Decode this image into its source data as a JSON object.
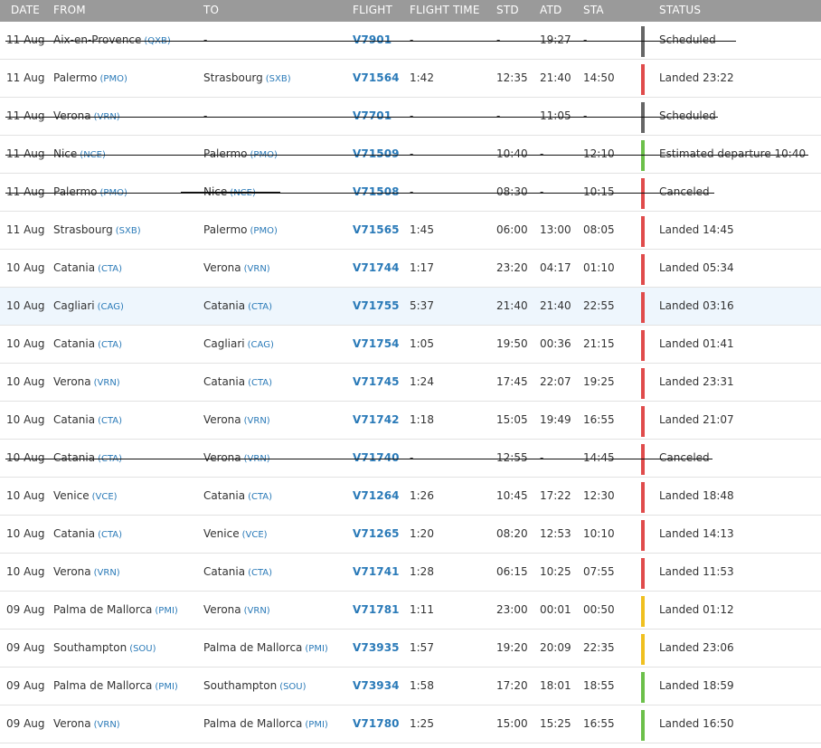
{
  "headers": {
    "date": "DATE",
    "from": "FROM",
    "to": "TO",
    "flight": "FLIGHT",
    "flight_time": "FLIGHT TIME",
    "std": "STD",
    "atd": "ATD",
    "sta": "STA",
    "status": "STATUS"
  },
  "colors": {
    "header_bg": "#9a9a9a",
    "link_blue": "#2a7ab8",
    "status_landed": "#e04b4b",
    "status_scheduled": "#666666",
    "status_estimated": "#6cc04a",
    "status_early": "#f0c020",
    "highlight_row": "#eef6fd"
  },
  "rows": [
    {
      "date": "11 Aug",
      "from": "Aix-en-Provence",
      "from_code": "(QXB)",
      "to": "-",
      "to_code": "",
      "flight": "V7901",
      "flight_time": "-",
      "std": "-",
      "atd": "19:27",
      "sta": "-",
      "status": "Scheduled",
      "bar": "gray",
      "struck": true,
      "strike": "c1"
    },
    {
      "date": "11 Aug",
      "from": "Palermo",
      "from_code": "(PMO)",
      "to": "Strasbourg",
      "to_code": "(SXB)",
      "flight": "V71564",
      "flight_time": "1:42",
      "std": "12:35",
      "atd": "21:40",
      "sta": "14:50",
      "status": "Landed 23:22",
      "bar": "red",
      "struck": false
    },
    {
      "date": "11 Aug",
      "from": "Verona",
      "from_code": "(VRN)",
      "to": "-",
      "to_code": "",
      "flight": "V7701",
      "flight_time": "-",
      "std": "-",
      "atd": "11:05",
      "sta": "-",
      "status": "Scheduled",
      "bar": "gray",
      "struck": true,
      "strike": "c2"
    },
    {
      "date": "11 Aug",
      "from": "Nice",
      "from_code": "(NCE)",
      "to": "Palermo",
      "to_code": "(PMO)",
      "flight": "V71509",
      "flight_time": "-",
      "std": "10:40",
      "atd": "-",
      "sta": "12:10",
      "status": "Estimated departure 10:40",
      "bar": "green",
      "struck": true,
      "strike": "c3"
    },
    {
      "date": "11 Aug",
      "from": "Palermo",
      "from_code": "(PMO)",
      "to": "Nice",
      "to_code": "(NCE)",
      "flight": "V71508",
      "flight_time": "-",
      "std": "08:30",
      "atd": "-",
      "sta": "10:15",
      "status": "Canceled",
      "bar": "red",
      "struck": true,
      "strike": "c4",
      "partial": true
    },
    {
      "date": "11 Aug",
      "from": "Strasbourg",
      "from_code": "(SXB)",
      "to": "Palermo",
      "to_code": "(PMO)",
      "flight": "V71565",
      "flight_time": "1:45",
      "std": "06:00",
      "atd": "13:00",
      "sta": "08:05",
      "status": "Landed 14:45",
      "bar": "red",
      "struck": false
    },
    {
      "date": "10 Aug",
      "from": "Catania",
      "from_code": "(CTA)",
      "to": "Verona",
      "to_code": "(VRN)",
      "flight": "V71744",
      "flight_time": "1:17",
      "std": "23:20",
      "atd": "04:17",
      "sta": "01:10",
      "status": "Landed 05:34",
      "bar": "red",
      "struck": false
    },
    {
      "date": "10 Aug",
      "from": "Cagliari",
      "from_code": "(CAG)",
      "to": "Catania",
      "to_code": "(CTA)",
      "flight": "V71755",
      "flight_time": "5:37",
      "std": "21:40",
      "atd": "21:40",
      "sta": "22:55",
      "status": "Landed 03:16",
      "bar": "red",
      "struck": false,
      "highlight": true
    },
    {
      "date": "10 Aug",
      "from": "Catania",
      "from_code": "(CTA)",
      "to": "Cagliari",
      "to_code": "(CAG)",
      "flight": "V71754",
      "flight_time": "1:05",
      "std": "19:50",
      "atd": "00:36",
      "sta": "21:15",
      "status": "Landed 01:41",
      "bar": "red",
      "struck": false
    },
    {
      "date": "10 Aug",
      "from": "Verona",
      "from_code": "(VRN)",
      "to": "Catania",
      "to_code": "(CTA)",
      "flight": "V71745",
      "flight_time": "1:24",
      "std": "17:45",
      "atd": "22:07",
      "sta": "19:25",
      "status": "Landed 23:31",
      "bar": "red",
      "struck": false
    },
    {
      "date": "10 Aug",
      "from": "Catania",
      "from_code": "(CTA)",
      "to": "Verona",
      "to_code": "(VRN)",
      "flight": "V71742",
      "flight_time": "1:18",
      "std": "15:05",
      "atd": "19:49",
      "sta": "16:55",
      "status": "Landed 21:07",
      "bar": "red",
      "struck": false
    },
    {
      "date": "10 Aug",
      "from": "Catania",
      "from_code": "(CTA)",
      "to": "Verona",
      "to_code": "(VRN)",
      "flight": "V71740",
      "flight_time": "-",
      "std": "12:55",
      "atd": "-",
      "sta": "14:45",
      "status": "Canceled",
      "bar": "red",
      "struck": true,
      "strike": "c5"
    },
    {
      "date": "10 Aug",
      "from": "Venice",
      "from_code": "(VCE)",
      "to": "Catania",
      "to_code": "(CTA)",
      "flight": "V71264",
      "flight_time": "1:26",
      "std": "10:45",
      "atd": "17:22",
      "sta": "12:30",
      "status": "Landed 18:48",
      "bar": "red",
      "struck": false
    },
    {
      "date": "10 Aug",
      "from": "Catania",
      "from_code": "(CTA)",
      "to": "Venice",
      "to_code": "(VCE)",
      "flight": "V71265",
      "flight_time": "1:20",
      "std": "08:20",
      "atd": "12:53",
      "sta": "10:10",
      "status": "Landed 14:13",
      "bar": "red",
      "struck": false
    },
    {
      "date": "10 Aug",
      "from": "Verona",
      "from_code": "(VRN)",
      "to": "Catania",
      "to_code": "(CTA)",
      "flight": "V71741",
      "flight_time": "1:28",
      "std": "06:15",
      "atd": "10:25",
      "sta": "07:55",
      "status": "Landed 11:53",
      "bar": "red",
      "struck": false
    },
    {
      "date": "09 Aug",
      "from": "Palma de Mallorca",
      "from_code": "(PMI)",
      "to": "Verona",
      "to_code": "(VRN)",
      "flight": "V71781",
      "flight_time": "1:11",
      "std": "23:00",
      "atd": "00:01",
      "sta": "00:50",
      "status": "Landed 01:12",
      "bar": "yellow",
      "struck": false
    },
    {
      "date": "09 Aug",
      "from": "Southampton",
      "from_code": "(SOU)",
      "to": "Palma de Mallorca",
      "to_code": "(PMI)",
      "flight": "V73935",
      "flight_time": "1:57",
      "std": "19:20",
      "atd": "20:09",
      "sta": "22:35",
      "status": "Landed 23:06",
      "bar": "yellow",
      "struck": false
    },
    {
      "date": "09 Aug",
      "from": "Palma de Mallorca",
      "from_code": "(PMI)",
      "to": "Southampton",
      "to_code": "(SOU)",
      "flight": "V73934",
      "flight_time": "1:58",
      "std": "17:20",
      "atd": "18:01",
      "sta": "18:55",
      "status": "Landed 18:59",
      "bar": "green",
      "struck": false
    },
    {
      "date": "09 Aug",
      "from": "Verona",
      "from_code": "(VRN)",
      "to": "Palma de Mallorca",
      "to_code": "(PMI)",
      "flight": "V71780",
      "flight_time": "1:25",
      "std": "15:00",
      "atd": "15:25",
      "sta": "16:55",
      "status": "Landed 16:50",
      "bar": "green",
      "struck": false
    }
  ]
}
